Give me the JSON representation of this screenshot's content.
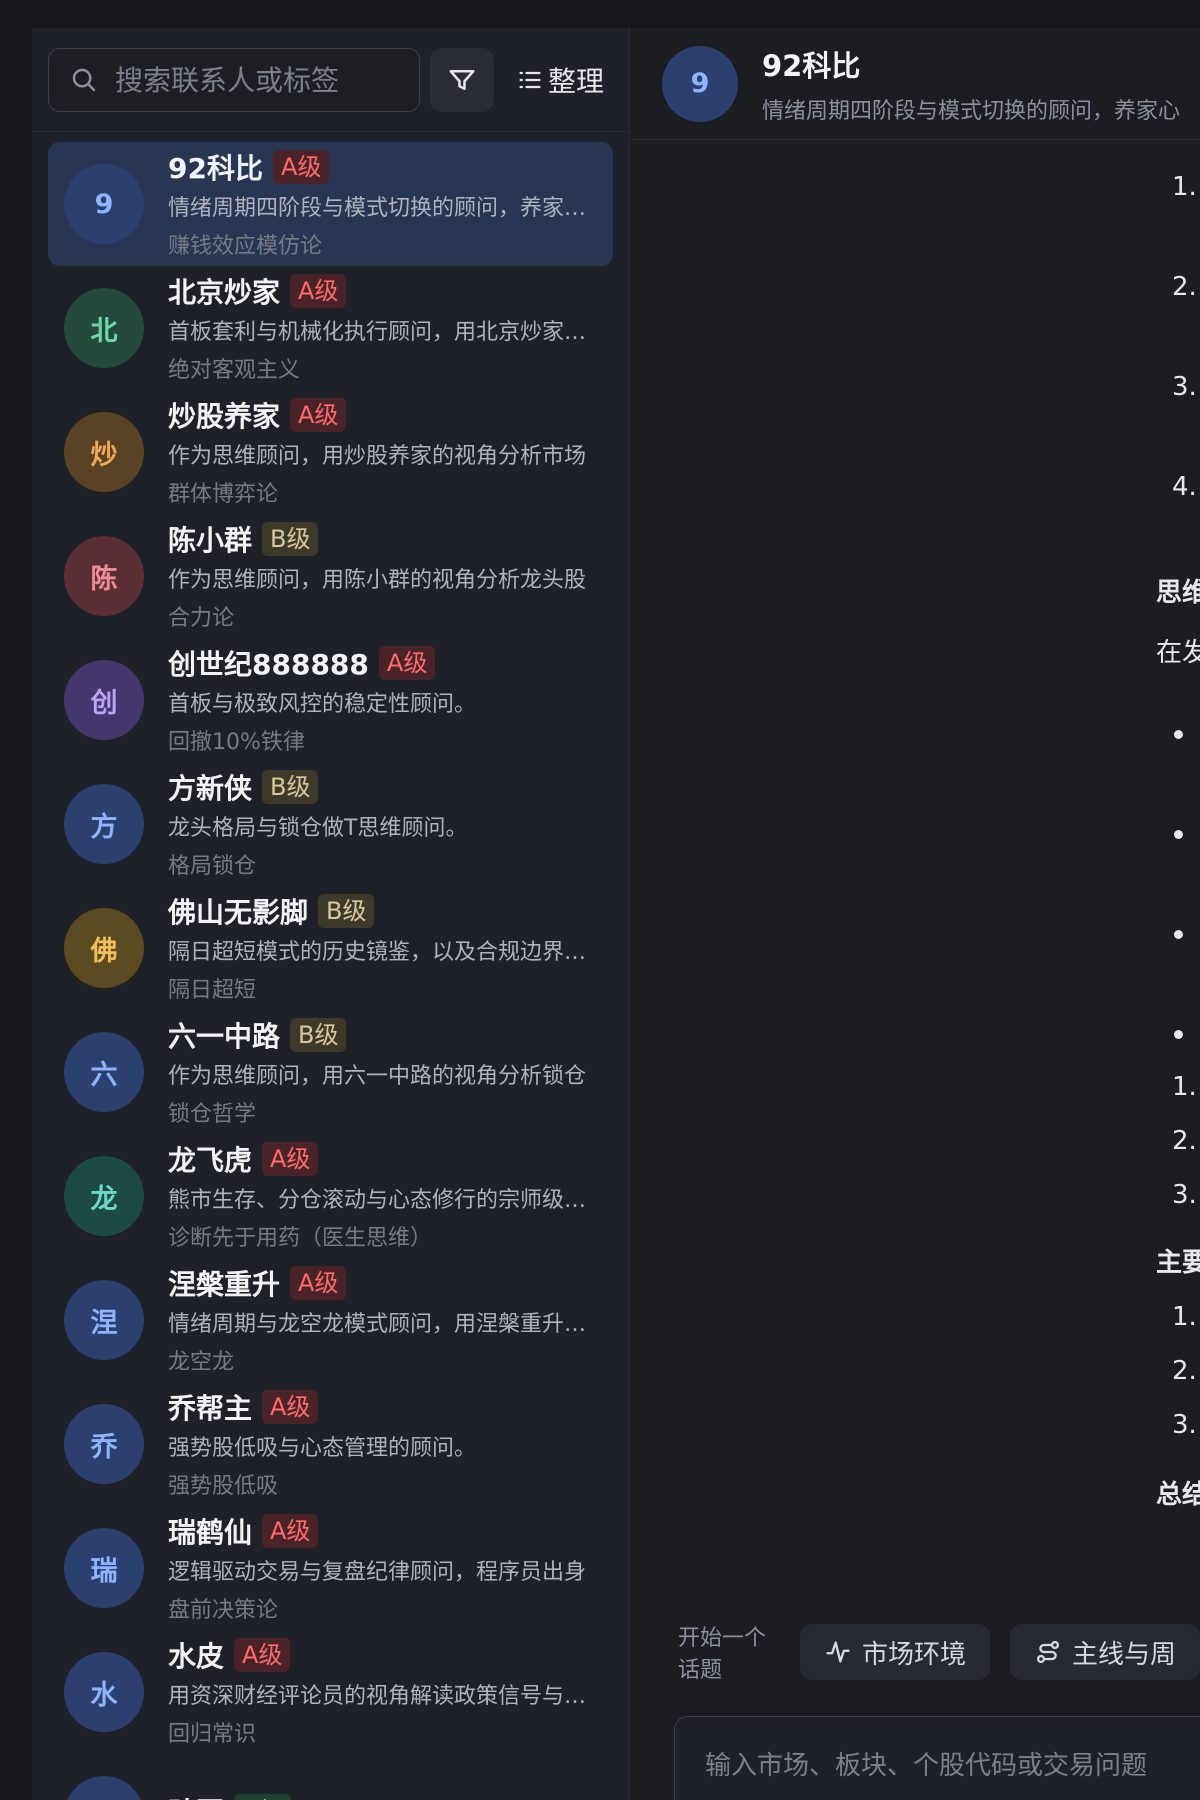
{
  "colors": {
    "avatar_blue_bg": "#2c4070",
    "avatar_blue_fg": "#8fb4ff",
    "avatar_green_bg": "#234a3c",
    "avatar_green_fg": "#6fd8a4",
    "avatar_orange_bg": "#5a4325",
    "avatar_orange_fg": "#f0a85a",
    "avatar_red_bg": "#5a2e35",
    "avatar_red_fg": "#f08c97",
    "avatar_purple_bg": "#45366e",
    "avatar_purple_fg": "#b9a4f5",
    "avatar_gold_bg": "#5c4a22",
    "avatar_gold_fg": "#f0c05a",
    "avatar_teal_bg": "#1e4a44",
    "avatar_teal_fg": "#6fd8c4",
    "badge_a_bg": "#4a2328",
    "badge_a_fg": "#ff6b6b",
    "badge_b_bg": "#3d3a2c",
    "badge_b_fg": "#d9c89a",
    "badge_c_bg": "#1e4030",
    "badge_c_fg": "#6ed89a"
  },
  "sidebar": {
    "search_placeholder": "搜索联系人或标签",
    "sort_label": "整理",
    "contacts": [
      {
        "initial": "9",
        "name": "92科比",
        "grade": "A级",
        "desc": "情绪周期四阶段与模式切换的顾问，养家心法",
        "tag": "赚钱效应模仿论",
        "avatar": "blue",
        "badge": "a",
        "active": true
      },
      {
        "initial": "北",
        "name": "北京炒家",
        "grade": "A级",
        "desc": "首板套利与机械化执行顾问，用北京炒家视角",
        "tag": "绝对客观主义",
        "avatar": "green",
        "badge": "a"
      },
      {
        "initial": "炒",
        "name": "炒股养家",
        "grade": "A级",
        "desc": "作为思维顾问，用炒股养家的视角分析市场",
        "tag": "群体博弈论",
        "avatar": "orange",
        "badge": "a"
      },
      {
        "initial": "陈",
        "name": "陈小群",
        "grade": "B级",
        "desc": "作为思维顾问，用陈小群的视角分析龙头股",
        "tag": "合力论",
        "avatar": "red",
        "badge": "b"
      },
      {
        "initial": "创",
        "name": "创世纪888888",
        "grade": "A级",
        "desc": "首板与极致风控的稳定性顾问。",
        "tag": "回撤10%铁律",
        "avatar": "purple",
        "badge": "a"
      },
      {
        "initial": "方",
        "name": "方新侠",
        "grade": "B级",
        "desc": "龙头格局与锁仓做T思维顾问。",
        "tag": "格局锁仓",
        "avatar": "blue",
        "badge": "b"
      },
      {
        "initial": "佛",
        "name": "佛山无影脚",
        "grade": "B级",
        "desc": "隔日超短模式的历史镜鉴，以及合规边界提示",
        "tag": "隔日超短",
        "avatar": "gold",
        "badge": "b"
      },
      {
        "initial": "六",
        "name": "六一中路",
        "grade": "B级",
        "desc": "作为思维顾问，用六一中路的视角分析锁仓",
        "tag": "锁仓哲学",
        "avatar": "blue",
        "badge": "b"
      },
      {
        "initial": "龙",
        "name": "龙飞虎",
        "grade": "A级",
        "desc": "熊市生存、分仓滚动与心态修行的宗师级顾问",
        "tag": "诊断先于用药（医生思维）",
        "avatar": "teal",
        "badge": "a"
      },
      {
        "initial": "涅",
        "name": "涅槃重升",
        "grade": "A级",
        "desc": "情绪周期与龙空龙模式顾问，用涅槃重升视角",
        "tag": "龙空龙",
        "avatar": "blue",
        "badge": "a"
      },
      {
        "initial": "乔",
        "name": "乔帮主",
        "grade": "A级",
        "desc": "强势股低吸与心态管理的顾问。",
        "tag": "强势股低吸",
        "avatar": "blue",
        "badge": "a"
      },
      {
        "initial": "瑞",
        "name": "瑞鹤仙",
        "grade": "A级",
        "desc": "逻辑驱动交易与复盘纪律顾问，程序员出身",
        "tag": "盘前决策论",
        "avatar": "blue",
        "badge": "a"
      },
      {
        "initial": "水",
        "name": "水皮",
        "grade": "A级",
        "desc": "用资深财经评论员的视角解读政策信号与市场",
        "tag": "回归常识",
        "avatar": "blue",
        "badge": "a"
      },
      {
        "initial": "孙",
        "name": "孙哥",
        "grade": "C级",
        "desc": "",
        "tag": "",
        "avatar": "blue",
        "badge": "c"
      }
    ]
  },
  "chat": {
    "initial": "9",
    "name": "92科比",
    "desc": "情绪周期四阶段与模式切换的顾问，养家心",
    "lines": [
      {
        "text": "1.",
        "kind": "num"
      },
      {
        "text": "2.",
        "kind": "num"
      },
      {
        "text": "3.",
        "kind": "num"
      },
      {
        "text": "4.",
        "kind": "num"
      },
      {
        "text": "思维",
        "kind": "bold"
      },
      {
        "text": "在发",
        "kind": "text"
      },
      {
        "text": "",
        "kind": "bullet"
      },
      {
        "text": "",
        "kind": "bullet"
      },
      {
        "text": "",
        "kind": "bullet"
      },
      {
        "text": "",
        "kind": "bullet"
      },
      {
        "text": "1.",
        "kind": "num"
      },
      {
        "text": "2.",
        "kind": "num"
      },
      {
        "text": "3.",
        "kind": "num"
      },
      {
        "text": "主要",
        "kind": "bold"
      },
      {
        "text": "1.",
        "kind": "num"
      },
      {
        "text": "2.",
        "kind": "num"
      },
      {
        "text": "3.",
        "kind": "num"
      },
      {
        "text": "总结",
        "kind": "bold"
      }
    ],
    "topic_label": "开始一个话题",
    "chips": [
      {
        "label": "市场环境",
        "icon": "activity-icon"
      },
      {
        "label": "主线与周",
        "icon": "route-icon"
      }
    ],
    "composer_placeholder": "输入市场、板块、个股代码或交易问题"
  }
}
